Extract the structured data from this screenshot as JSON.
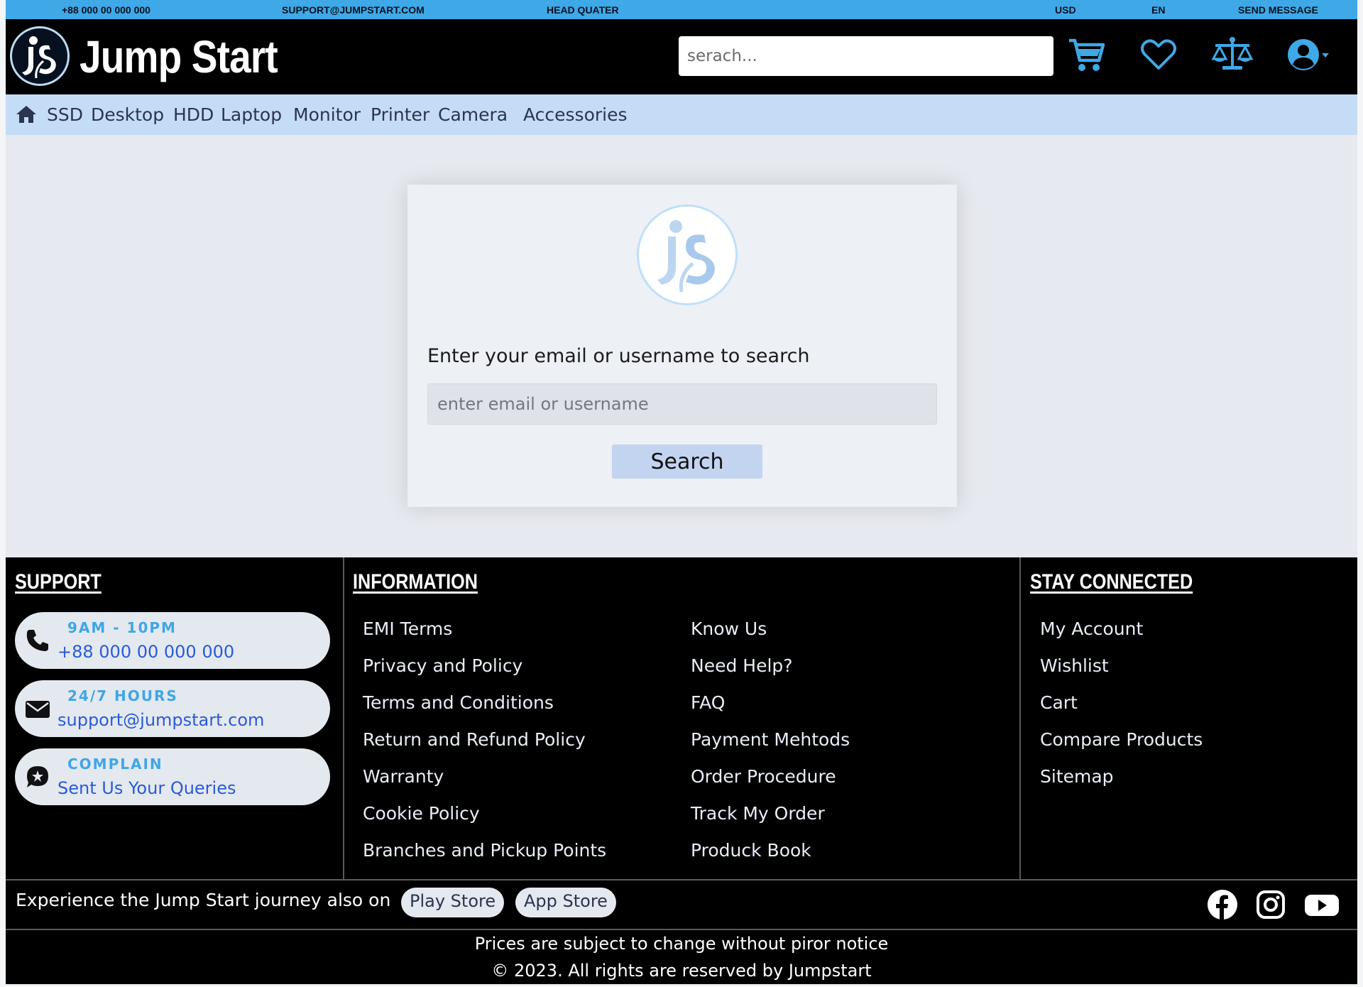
{
  "topbar": {
    "phone": "+88 000 00 000 000",
    "email": "SUPPORT@JUMPSTART.COM",
    "head_quarter": "HEAD QUATER",
    "currency": "USD",
    "language": "EN",
    "send_message": "SEND MESSAGE"
  },
  "header": {
    "brand": "Jump Start",
    "search_placeholder": "serach...",
    "icons": [
      "cart-icon",
      "heart-icon",
      "scale-icon",
      "user-icon"
    ]
  },
  "nav": {
    "items": [
      "SSD",
      "Desktop",
      "HDD",
      "Laptop",
      "Monitor",
      "Printer",
      "Camera",
      "Accessories"
    ]
  },
  "card": {
    "title": "Enter your email or username to search",
    "input_placeholder": "enter email or username",
    "button": "Search"
  },
  "footer": {
    "support": {
      "heading": "SUPPORT",
      "phone": {
        "top": "9AM - 10PM",
        "bottom": "+88 000 00 000 000"
      },
      "email": {
        "top": "24/7 HOURS",
        "bottom": "support@jumpstart.com"
      },
      "complain": {
        "top": "COMPLAIN",
        "bottom": "Sent Us Your Queries"
      }
    },
    "information": {
      "heading": "INFORMATION",
      "col1": [
        "EMI Terms",
        "Privacy and Policy",
        "Terms and Conditions",
        "Return and Refund Policy",
        "Warranty",
        "Cookie Policy",
        "Branches and Pickup Points"
      ],
      "col2": [
        "Know Us",
        "Need Help?",
        "FAQ",
        "Payment Mehtods",
        "Order Procedure",
        "Track My Order",
        "Produck Book"
      ]
    },
    "stay_connected": {
      "heading": "STAY CONNECTED",
      "links": [
        "My Account",
        "Wishlist",
        "Cart",
        "Compare Products",
        "Sitemap"
      ]
    },
    "apps": {
      "text": "Experience the Jump Start journey also on",
      "play_store": "Play Store",
      "app_store": "App Store"
    },
    "notice": "Prices are subject to change without piror notice",
    "copyright": "© 2023. All rights are reserved by Jumpstart"
  },
  "colors": {
    "topbar": "#3ea9e6",
    "nav": "#c5dcf7",
    "accent_blue": "#2a5bd8",
    "pill_label": "#3fa6e6"
  }
}
